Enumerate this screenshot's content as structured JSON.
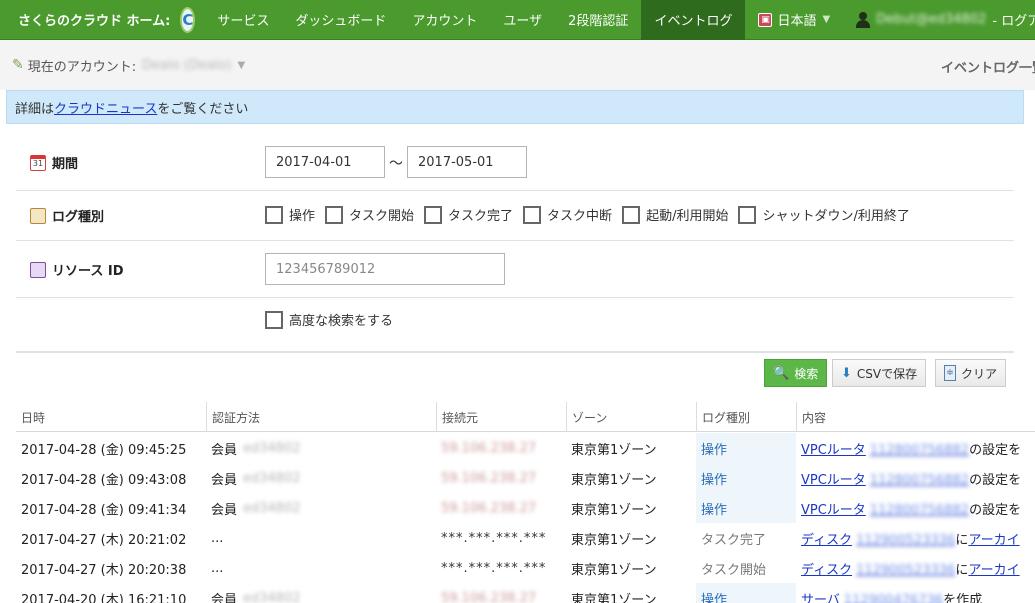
{
  "header": {
    "brand": "さくらのクラウド ホーム:",
    "refresh_glyph": "C",
    "nav": [
      "サービス",
      "ダッシュボード",
      "アカウント",
      "ユーザ",
      "2段階認証",
      "イベントログ"
    ],
    "active_nav": "イベントログ",
    "language": "日本語",
    "language_caret": "▼",
    "user": "Debut@ed34802",
    "logout": "- ログアウト",
    "colors": {
      "bar": "#4a9a2e",
      "active": "#2e6b1c"
    }
  },
  "account": {
    "label": "現在のアカウント:",
    "name": "Dealo (Dealo)",
    "caret": "▼",
    "page_crumb": "イベントログ一覧"
  },
  "notice": {
    "prefix": "詳細は",
    "link": "クラウドニュース",
    "suffix": "をご覧ください"
  },
  "form": {
    "period": {
      "label": "期間",
      "icon": "calendar-icon",
      "icon_text": "31",
      "from": "2017-04-01",
      "to": "2017-05-01",
      "separator": "〜"
    },
    "log_type": {
      "label": "ログ種別",
      "icon": "log-icon",
      "options": [
        "操作",
        "タスク開始",
        "タスク完了",
        "タスク中断",
        "起動/利用開始",
        "シャットダウン/利用終了"
      ]
    },
    "resource_id": {
      "label": "リソース ID",
      "icon": "resource-icon",
      "placeholder": "123456789012"
    },
    "advanced": {
      "label": "高度な検索をする"
    }
  },
  "buttons": {
    "search": "検索",
    "search_glyph": "🔍",
    "csv": "CSVで保存",
    "csv_glyph": "⬇",
    "clear": "クリア",
    "clear_glyph": "≑"
  },
  "table": {
    "columns": [
      "日時",
      "認証方法",
      "接続元",
      "ゾーン",
      "ログ種別",
      "内容"
    ],
    "rows": [
      {
        "datetime": "2017-04-28 (金) 09:45:25",
        "auth": "会員",
        "auth_id": "ed34802",
        "source": "59.106.238.27",
        "zone": "東京第1ゾーン",
        "log_type": "操作",
        "link": "VPCルータ",
        "resource": "112800756882",
        "action": "の設定を"
      },
      {
        "datetime": "2017-04-28 (金) 09:43:08",
        "auth": "会員",
        "auth_id": "ed34802",
        "source": "59.106.238.27",
        "zone": "東京第1ゾーン",
        "log_type": "操作",
        "link": "VPCルータ",
        "resource": "112800756882",
        "action": "の設定を"
      },
      {
        "datetime": "2017-04-28 (金) 09:41:34",
        "auth": "会員",
        "auth_id": "ed34802",
        "source": "59.106.238.27",
        "zone": "東京第1ゾーン",
        "log_type": "操作",
        "link": "VPCルータ",
        "resource": "112800756882",
        "action": "の設定を"
      },
      {
        "datetime": "2017-04-27 (木) 20:21:02",
        "auth": "...",
        "auth_id": "",
        "source": "***.***.***.***",
        "zone": "東京第1ゾーン",
        "log_type": "タスク完了",
        "link": "ディスク",
        "resource": "112900523336",
        "action": "に",
        "action_link": "アーカイ"
      },
      {
        "datetime": "2017-04-27 (木) 20:20:38",
        "auth": "...",
        "auth_id": "",
        "source": "***.***.***.***",
        "zone": "東京第1ゾーン",
        "log_type": "タスク開始",
        "link": "ディスク",
        "resource": "112900523336",
        "action": "に",
        "action_link": "アーカイ"
      },
      {
        "datetime": "2017-04-20 (木) 16:21:10",
        "auth": "会員",
        "auth_id": "ed34802",
        "source": "59.106.238.27",
        "zone": "東京第1ゾーン",
        "log_type": "操作",
        "link": "サーバ",
        "resource": "112900476736",
        "action": "を作成"
      }
    ]
  }
}
